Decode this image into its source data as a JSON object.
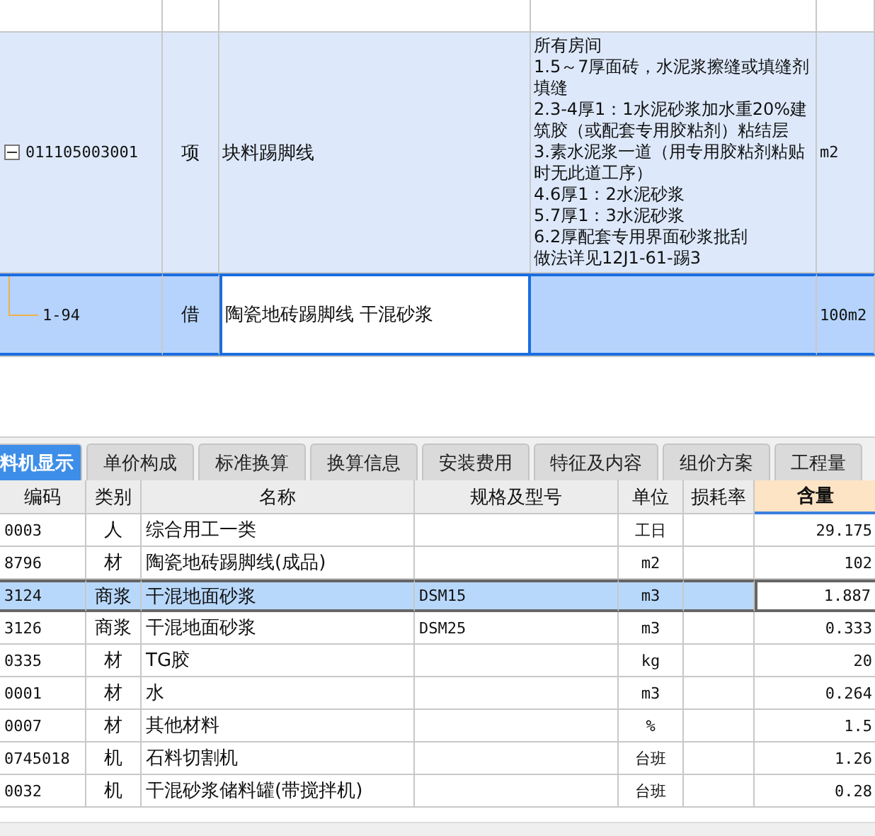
{
  "bill_rows": [
    {
      "kind": "item",
      "code": "011105003001",
      "type": "项",
      "name": "块料踢脚线",
      "features": [
        "所有房间",
        "1.5～7厚面砖，水泥浆擦缝或填缝剂填缝",
        "2.3-4厚1：1水泥砂浆加水重20%建筑胶（或配套专用胶粘剂）粘结层",
        "3.素水泥浆一道（用专用胶粘剂粘贴时无此道工序）",
        "4.6厚1：2水泥砂浆",
        "5.7厚1：3水泥砂浆",
        "6.2厚配套专用界面砂浆批刮",
        "做法详见12J1-61-踢3"
      ],
      "unit": "m2",
      "expanded": true,
      "selected": false
    },
    {
      "kind": "quota",
      "code": "1-94",
      "type": "借",
      "name": "陶瓷地砖踢脚线 干混砂浆",
      "features": [],
      "unit": "100m2",
      "selected": true
    }
  ],
  "tabs": [
    {
      "label": "料机显示",
      "selected": true
    },
    {
      "label": "单价构成",
      "selected": false
    },
    {
      "label": "标准换算",
      "selected": false
    },
    {
      "label": "换算信息",
      "selected": false
    },
    {
      "label": "安装费用",
      "selected": false
    },
    {
      "label": "特征及内容",
      "selected": false
    },
    {
      "label": "组价方案",
      "selected": false
    },
    {
      "label": "工程量",
      "selected": false
    }
  ],
  "columns": [
    {
      "label": "编码",
      "selected": false
    },
    {
      "label": "类别",
      "selected": false
    },
    {
      "label": "名称",
      "selected": false
    },
    {
      "label": "规格及型号",
      "selected": false
    },
    {
      "label": "单位",
      "selected": false
    },
    {
      "label": "损耗率",
      "selected": false
    },
    {
      "label": "含量",
      "selected": true
    }
  ],
  "rows": [
    {
      "code": "0003",
      "type": "人",
      "name": "综合用工一类",
      "spec": "",
      "unit": "工日",
      "loss": "",
      "qty": "29.175",
      "selected": false
    },
    {
      "code": "8796",
      "type": "材",
      "name": "陶瓷地砖踢脚线(成品)",
      "spec": "",
      "unit": "m2",
      "loss": "",
      "qty": "102",
      "selected": false
    },
    {
      "code": "3124",
      "type": "商浆",
      "name": "干混地面砂浆",
      "spec": "DSM15",
      "unit": "m3",
      "loss": "",
      "qty": "1.887",
      "selected": true
    },
    {
      "code": "3126",
      "type": "商浆",
      "name": "干混地面砂浆",
      "spec": "DSM25",
      "unit": "m3",
      "loss": "",
      "qty": "0.333",
      "selected": false
    },
    {
      "code": "0335",
      "type": "材",
      "name": "TG胶",
      "spec": "",
      "unit": "kg",
      "loss": "",
      "qty": "20",
      "selected": false
    },
    {
      "code": "0001",
      "type": "材",
      "name": "水",
      "spec": "",
      "unit": "m3",
      "loss": "",
      "qty": "0.264",
      "selected": false
    },
    {
      "code": "0007",
      "type": "材",
      "name": "其他材料",
      "spec": "",
      "unit": "%",
      "loss": "",
      "qty": "1.5",
      "selected": false
    },
    {
      "code": "0745018",
      "type": "机",
      "name": "石料切割机",
      "spec": "",
      "unit": "台班",
      "loss": "",
      "qty": "1.26",
      "selected": false
    },
    {
      "code": "0032",
      "type": "机",
      "name": "干混砂浆储料罐(带搅拌机)",
      "spec": "",
      "unit": "台班",
      "loss": "",
      "qty": "0.28",
      "selected": false
    }
  ]
}
